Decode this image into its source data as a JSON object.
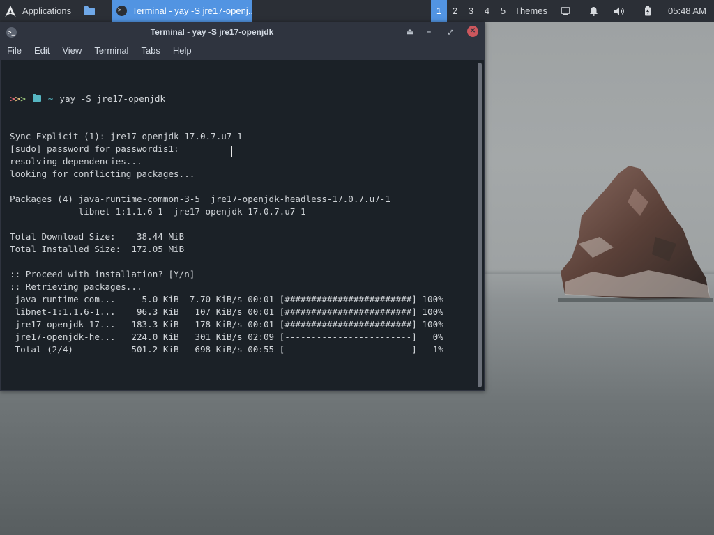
{
  "panel": {
    "applications_label": "Applications",
    "task_title": "Terminal - yay -S jre17-openj...",
    "workspaces": [
      "1",
      "2",
      "3",
      "4",
      "5"
    ],
    "active_workspace": "1",
    "themes_label": "Themes",
    "clock": "05:48 AM",
    "accent_color": "#5294e2"
  },
  "window": {
    "title": "Terminal - yay -S jre17-openjdk",
    "menu": [
      "File",
      "Edit",
      "View",
      "Terminal",
      "Tabs",
      "Help"
    ]
  },
  "terminal": {
    "prompt_arrows": ">>>",
    "prompt_tilde": "~",
    "command": "yay -S jre17-openjdk",
    "output": "Sync Explicit (1): jre17-openjdk-17.0.7.u7-1\n[sudo] password for passwordis1:\nresolving dependencies...\nlooking for conflicting packages...\n\nPackages (4) java-runtime-common-3-5  jre17-openjdk-headless-17.0.7.u7-1\n             libnet-1:1.1.6-1  jre17-openjdk-17.0.7.u7-1\n\nTotal Download Size:    38.44 MiB\nTotal Installed Size:  172.05 MiB\n\n:: Proceed with installation? [Y/n]\n:: Retrieving packages...\n java-runtime-com...     5.0 KiB  7.70 KiB/s 00:01 [########################] 100%\n libnet-1:1.1.6-1...    96.3 KiB   107 KiB/s 00:01 [########################] 100%\n jre17-openjdk-17...   183.3 KiB   178 KiB/s 00:01 [########################] 100%\n jre17-openjdk-he...   224.0 KiB   301 KiB/s 02:09 [------------------------]   0%\n Total (2/4)           501.2 KiB   698 KiB/s 00:55 [------------------------]   1%"
  }
}
